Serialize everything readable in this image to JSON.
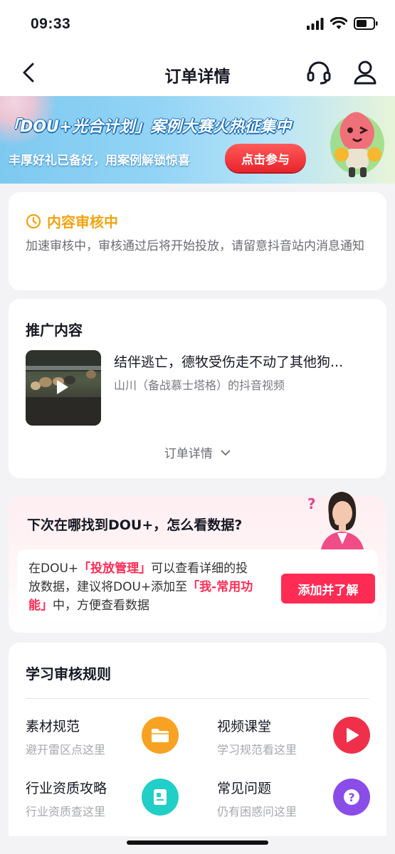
{
  "status_bar": {
    "time": "09:33"
  },
  "nav": {
    "title": "订单详情",
    "back_icon": "chevron-left-icon",
    "service_icon": "headset-icon",
    "user_icon": "user-icon"
  },
  "banner": {
    "title": "「DOU+光合计划」案例大赛火热征集中",
    "subtitle": "丰厚好礼已备好，用案例解锁惊喜",
    "button": "点击参与"
  },
  "review": {
    "status": "内容审核中",
    "description": "加速审核中，审核通过后将开始投放，请留意抖音站内消息通知",
    "status_color": "#f2a30f"
  },
  "promo": {
    "title": "推广内容",
    "video_title": "结伴逃亡，德牧受伤走不动了其他狗...",
    "author": "山川（备战慕士塔格）的抖音视频",
    "details_link": "订单详情"
  },
  "dou_tip": {
    "title": "下次在哪找到DOU+，怎么看数据?",
    "text_1": "在DOU+",
    "highlight_1": "「投放管理」",
    "text_2": "可以查看详细的投放数据，建议将DOU+添加至",
    "highlight_2": "「我-常用功能」",
    "text_3": "中，方便查看数据",
    "button": "添加并了解",
    "accent": "#fe2c55"
  },
  "rules": {
    "title": "学习审核规则",
    "items": [
      {
        "name": "素材规范",
        "sub": "避开雷区点这里",
        "icon": "folder-icon",
        "color": "#f7a221"
      },
      {
        "name": "视频课堂",
        "sub": "学习规范看这里",
        "icon": "play-icon",
        "color": "#f0304a"
      },
      {
        "name": "行业资质攻略",
        "sub": "行业资质查这里",
        "icon": "document-icon",
        "color": "#22cfc6"
      },
      {
        "name": "常见问题",
        "sub": "仍有困惑问这里",
        "icon": "question-icon",
        "color": "#8a4de8"
      }
    ]
  }
}
